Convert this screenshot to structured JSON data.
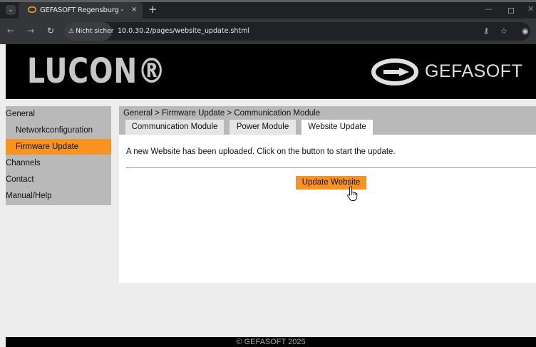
{
  "browser": {
    "tab_title": "GEFASOFT Regensburg - LUCON",
    "tab_close": "×",
    "new_tab": "+",
    "security_label": "Nicht sicher",
    "url": "10.0.30.2/pages/website_update.shtml"
  },
  "header": {
    "logo": "LUCON®",
    "brand": "GEFASOFT"
  },
  "sidebar": {
    "items": [
      {
        "label": "General"
      },
      {
        "label": "Networkconfiguration"
      },
      {
        "label": "Firmware Update"
      },
      {
        "label": "Channels"
      },
      {
        "label": "Contact"
      },
      {
        "label": "Manual/Help"
      }
    ]
  },
  "main": {
    "breadcrumb": "General > Firmware Update > Communication Module",
    "tabs": [
      {
        "label": "Communication Module"
      },
      {
        "label": "Power Module"
      },
      {
        "label": "Website Update"
      }
    ],
    "message": "A new Website has been uploaded. Click on the button to start the update.",
    "update_button": "Update Website"
  },
  "footer": {
    "copyright": "© GEFASOFT 2025"
  },
  "colors": {
    "accent": "#f7931e",
    "sidebar_bg": "#b9b9b9",
    "header_bg": "#000000"
  }
}
